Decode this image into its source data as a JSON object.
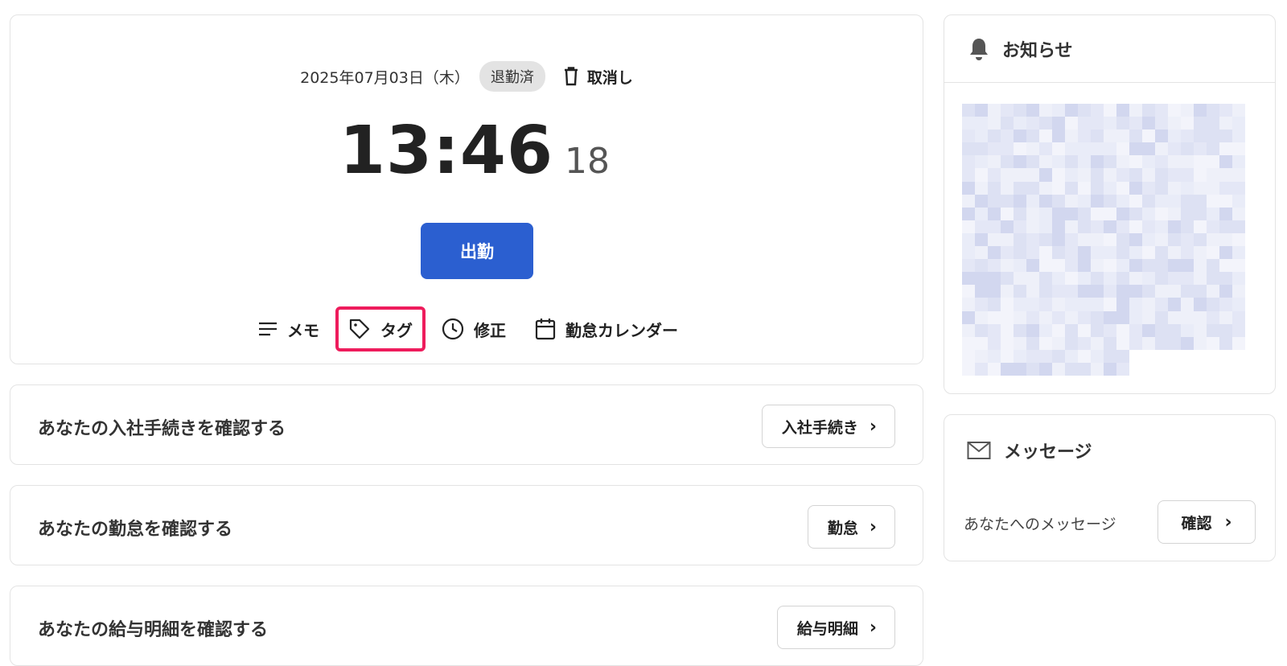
{
  "clock": {
    "date": "2025年07月03日（木）",
    "status": "退勤済",
    "cancel_label": "取消し",
    "time": "13:46",
    "seconds": "18",
    "clock_in_label": "出勤",
    "actions": [
      {
        "label": "メモ",
        "icon": "menu-lines-icon"
      },
      {
        "label": "タグ",
        "icon": "tag-icon"
      },
      {
        "label": "修正",
        "icon": "clock-icon"
      },
      {
        "label": "勤怠カレンダー",
        "icon": "calendar-icon"
      }
    ],
    "highlight_color": "#ee1c5c",
    "button_color": "#2b5fd0"
  },
  "links": [
    {
      "title": "あなたの入社手続きを確認する",
      "button": "入社手続き"
    },
    {
      "title": "あなたの勤怠を確認する",
      "button": "勤怠"
    },
    {
      "title": "あなたの給与明細を確認する",
      "button": "給与明細"
    }
  ],
  "news": {
    "title": "お知らせ",
    "icon": "bell-icon"
  },
  "messages": {
    "title": "メッセージ",
    "icon": "mail-icon",
    "text": "あなたへのメッセージ",
    "button": "確認"
  }
}
